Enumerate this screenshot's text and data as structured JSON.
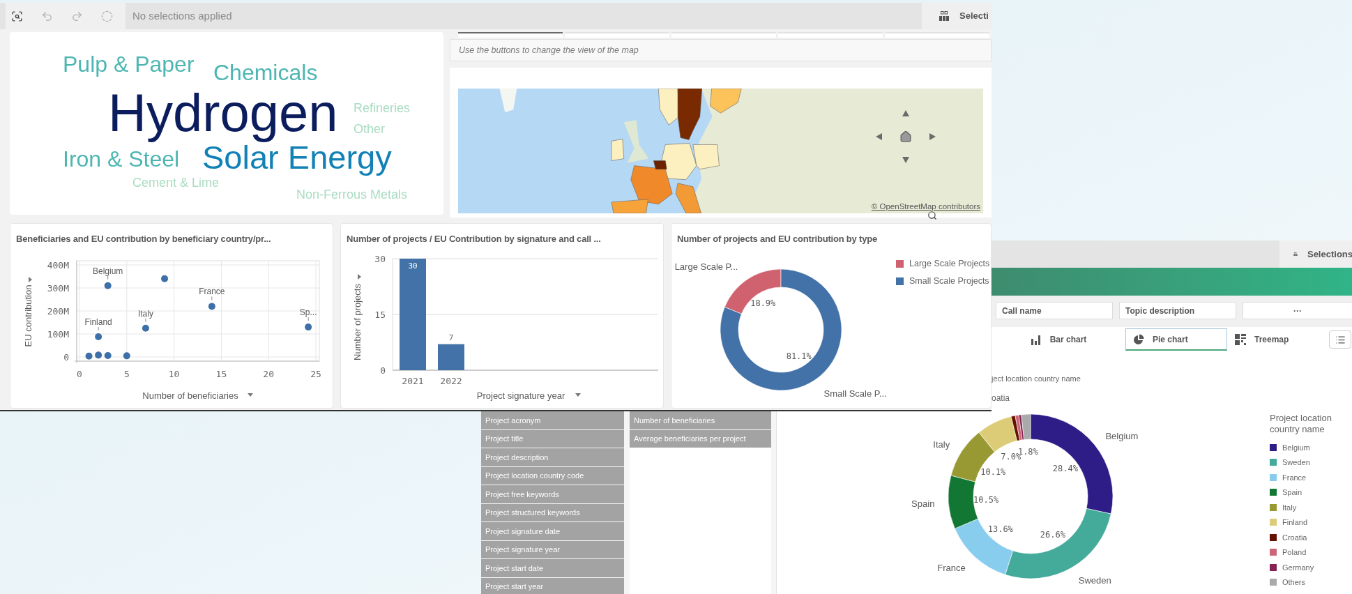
{
  "main_window": {
    "toolbar": {
      "status": "No selections applied",
      "selections_label": "Selecti"
    },
    "word_cloud": {
      "words": [
        {
          "text": "Pulp & Paper",
          "kind": "m",
          "color": "#4db6b2"
        },
        {
          "text": "Chemicals",
          "kind": "m",
          "color": "#4db6b2"
        },
        {
          "text": "Hydrogen",
          "kind": "xl",
          "color": "#0c1d5e"
        },
        {
          "text": "Refineries",
          "kind": "s",
          "color": "#a9dcc1"
        },
        {
          "text": "Other",
          "kind": "s",
          "color": "#a9dcc1"
        },
        {
          "text": "Iron & Steel",
          "kind": "m",
          "color": "#4db6b2"
        },
        {
          "text": "Solar Energy",
          "kind": "l",
          "color": "#1281b5"
        },
        {
          "text": "Cement & Lime",
          "kind": "s",
          "color": "#a9dcc1"
        },
        {
          "text": "Non-Ferrous Metals",
          "kind": "s",
          "color": "#a9dcc1"
        }
      ]
    },
    "map": {
      "tabs": [
        {
          "selected": true
        },
        {
          "selected": false
        },
        {
          "selected": false
        },
        {
          "selected": false
        },
        {
          "selected": false
        }
      ],
      "hint": "Use the buttons to change the view of the map",
      "attribution": "© OpenStreetMap contributors"
    },
    "scatter": {
      "title": "Beneficiaries and EU contribution by beneficiary country/pr...",
      "chart_data": {
        "type": "scatter",
        "xlabel": "Number of beneficiaries",
        "ylabel": "EU contribution",
        "xlim": [
          0,
          25
        ],
        "ylim": [
          0,
          400
        ],
        "grid": true,
        "xticks": [
          0,
          5,
          10,
          15,
          20,
          25
        ],
        "yticks": [
          {
            "value": 0,
            "label": "0"
          },
          {
            "value": 100,
            "label": "100M"
          },
          {
            "value": 200,
            "label": "200M"
          },
          {
            "value": 300,
            "label": "300M"
          },
          {
            "value": 400,
            "label": "400M"
          }
        ],
        "x": [
          3,
          9,
          14,
          7,
          2,
          24.2,
          1,
          2,
          3,
          5
        ],
        "series": [
          {
            "color": "#3d70a8",
            "values": [
              310,
              340,
              220,
              125,
              88,
              130,
              4,
              8,
              6,
              5
            ]
          }
        ],
        "annotations": [
          {
            "x": 3,
            "y": 310,
            "text": "Belgium"
          },
          {
            "x": 14,
            "y": 220,
            "text": "France"
          },
          {
            "x": 7,
            "y": 125,
            "text": "Italy"
          },
          {
            "x": 2,
            "y": 88,
            "text": "Finland"
          },
          {
            "x": 24.2,
            "y": 130,
            "text": "Sp..."
          }
        ]
      }
    },
    "bar": {
      "title": "Number of projects / EU Contribution by signature and call ...",
      "chart_data": {
        "type": "bar",
        "xlabel": "Project signature year",
        "ylabel": "Number of projects",
        "categories": [
          "2021",
          "2022"
        ],
        "ylim": [
          0,
          30
        ],
        "yticks": [
          0,
          15,
          30
        ],
        "grid": true,
        "series": [
          {
            "color": "#4272a8",
            "values": [
              30,
              7
            ]
          }
        ],
        "data_labels": true
      }
    },
    "type_chart": {
      "title": "Number of projects and EU contribution by type",
      "chart_data": {
        "type": "donut",
        "categories": [
          "Large Scale Projects",
          "Small Scale Projects"
        ],
        "series": [
          {
            "values": [
              18.9,
              81.1
            ]
          }
        ],
        "value_labels": [
          "18.9%",
          "81.1%"
        ]
      },
      "legend": [
        {
          "color": "#d0626f",
          "slice_label": "Large Scale P..."
        },
        {
          "color": "#4272a8",
          "slice_label": "Small Scale P..."
        }
      ]
    }
  },
  "second_window": {
    "toolbar": {
      "selections_label": "Selections"
    },
    "filters": [
      {
        "label": "Call name"
      },
      {
        "label": "Topic description"
      },
      {
        "label": "···"
      }
    ],
    "view_tabs": [
      {
        "label": "Bar chart",
        "kind": "bar",
        "selected": false
      },
      {
        "label": "Pie chart",
        "kind": "pie",
        "selected": true
      },
      {
        "label": "Treemap",
        "kind": "treemap",
        "selected": false
      }
    ],
    "fields": [
      "Project acronym",
      "Project title",
      "Project description",
      "Project location country code",
      "Project free keywords",
      "Project structured keywords",
      "Project signature date",
      "Project signature year",
      "Project start date",
      "Project start year"
    ],
    "measures": [
      "Number of beneficiaries",
      "Average beneficiaries per project"
    ],
    "pie": {
      "subtitle": "ject location country name",
      "cut_label": "oatia",
      "legend_title": "Project location country name",
      "chart_data": {
        "type": "donut",
        "categories": [
          "Belgium",
          "Sweden",
          "France",
          "Spain",
          "Italy",
          "Finland",
          "Croatia",
          "Poland",
          "Germany",
          "Others"
        ],
        "series": [
          {
            "values": [
              28.4,
              26.6,
              13.6,
              10.5,
              10.1,
              7.0,
              0.8,
              0.7,
              0.5,
              1.8
            ]
          }
        ],
        "value_labels": [
          "28.4%",
          "26.6%",
          "13.6%",
          "10.5%",
          "10.1%",
          "7.0%",
          null,
          null,
          null,
          "1.8%"
        ]
      },
      "legend": [
        {
          "color": "#2f1d87",
          "slice_label": "Belgium"
        },
        {
          "color": "#44aa99",
          "slice_label": "Sweden"
        },
        {
          "color": "#88ccee",
          "slice_label": "France"
        },
        {
          "color": "#117733",
          "slice_label": "Spain"
        },
        {
          "color": "#999933",
          "slice_label": "Italy"
        },
        {
          "color": "#ddcc77"
        },
        {
          "color": "#661100"
        },
        {
          "color": "#cc6677"
        },
        {
          "color": "#882255"
        },
        {
          "color": "#aaaaaa"
        }
      ]
    }
  }
}
